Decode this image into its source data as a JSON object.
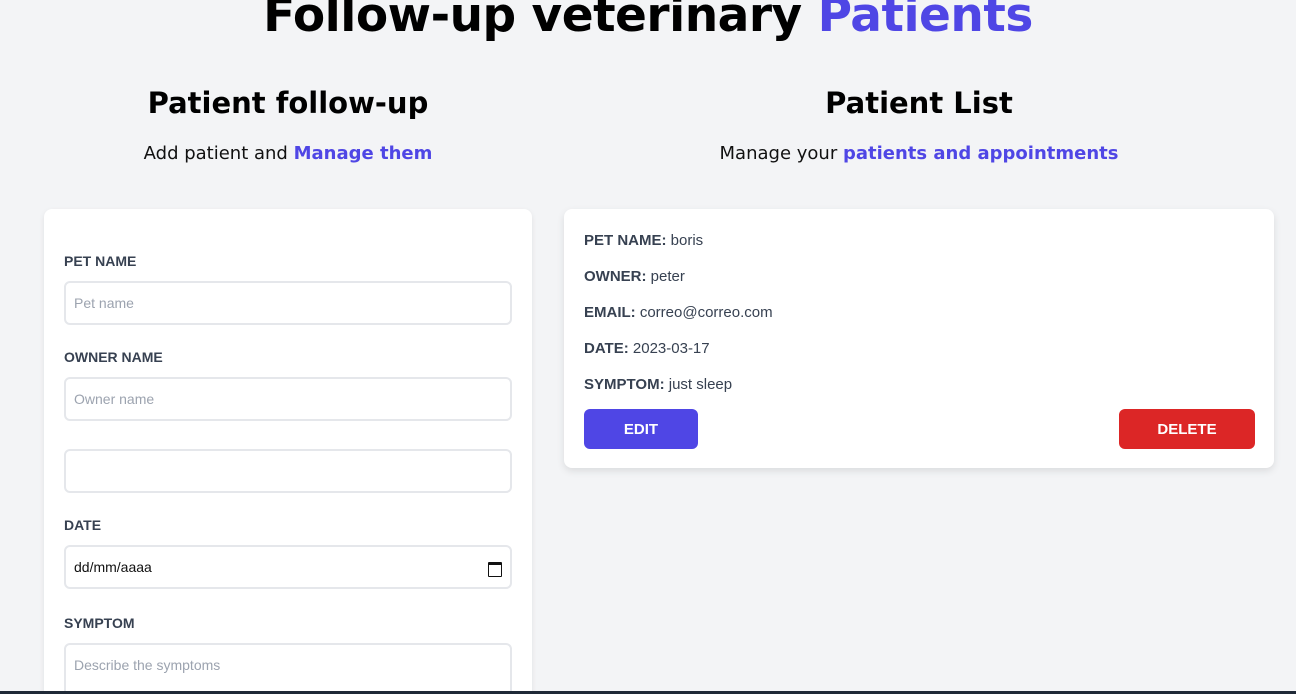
{
  "header": {
    "title_main": "Follow-up veterinary",
    "title_accent": "Patients"
  },
  "form_section": {
    "heading": "Patient follow-up",
    "subtitle_text": "Add patient and",
    "subtitle_link": "Manage them"
  },
  "list_section": {
    "heading": "Patient List",
    "subtitle_text": "Manage your",
    "subtitle_link": "patients and appointments"
  },
  "form": {
    "pet_name_label": "PET NAME",
    "pet_name_placeholder": "Pet name",
    "owner_name_label": "OWNER NAME",
    "owner_name_placeholder": "Owner name",
    "email_value": "",
    "date_label": "DATE",
    "date_placeholder": "dd/mm/aaaa",
    "symptom_label": "SYMPTOM",
    "symptom_placeholder": "Describe the symptoms"
  },
  "patient": {
    "pet_label": "PET NAME:",
    "pet_value": "boris",
    "owner_label": "OWNER:",
    "owner_value": "peter",
    "email_label": "EMAIL:",
    "email_value": "correo@correo.com",
    "date_label": "DATE:",
    "date_value": "2023-03-17",
    "symptom_label": "SYMPTOM:",
    "symptom_value": "just sleep",
    "edit_label": "EDIT",
    "delete_label": "DELETE"
  },
  "colors": {
    "accent": "#4f46e5",
    "danger": "#dc2626",
    "background": "#f3f4f6"
  },
  "icons": {
    "date_picker": "calendar-icon"
  }
}
